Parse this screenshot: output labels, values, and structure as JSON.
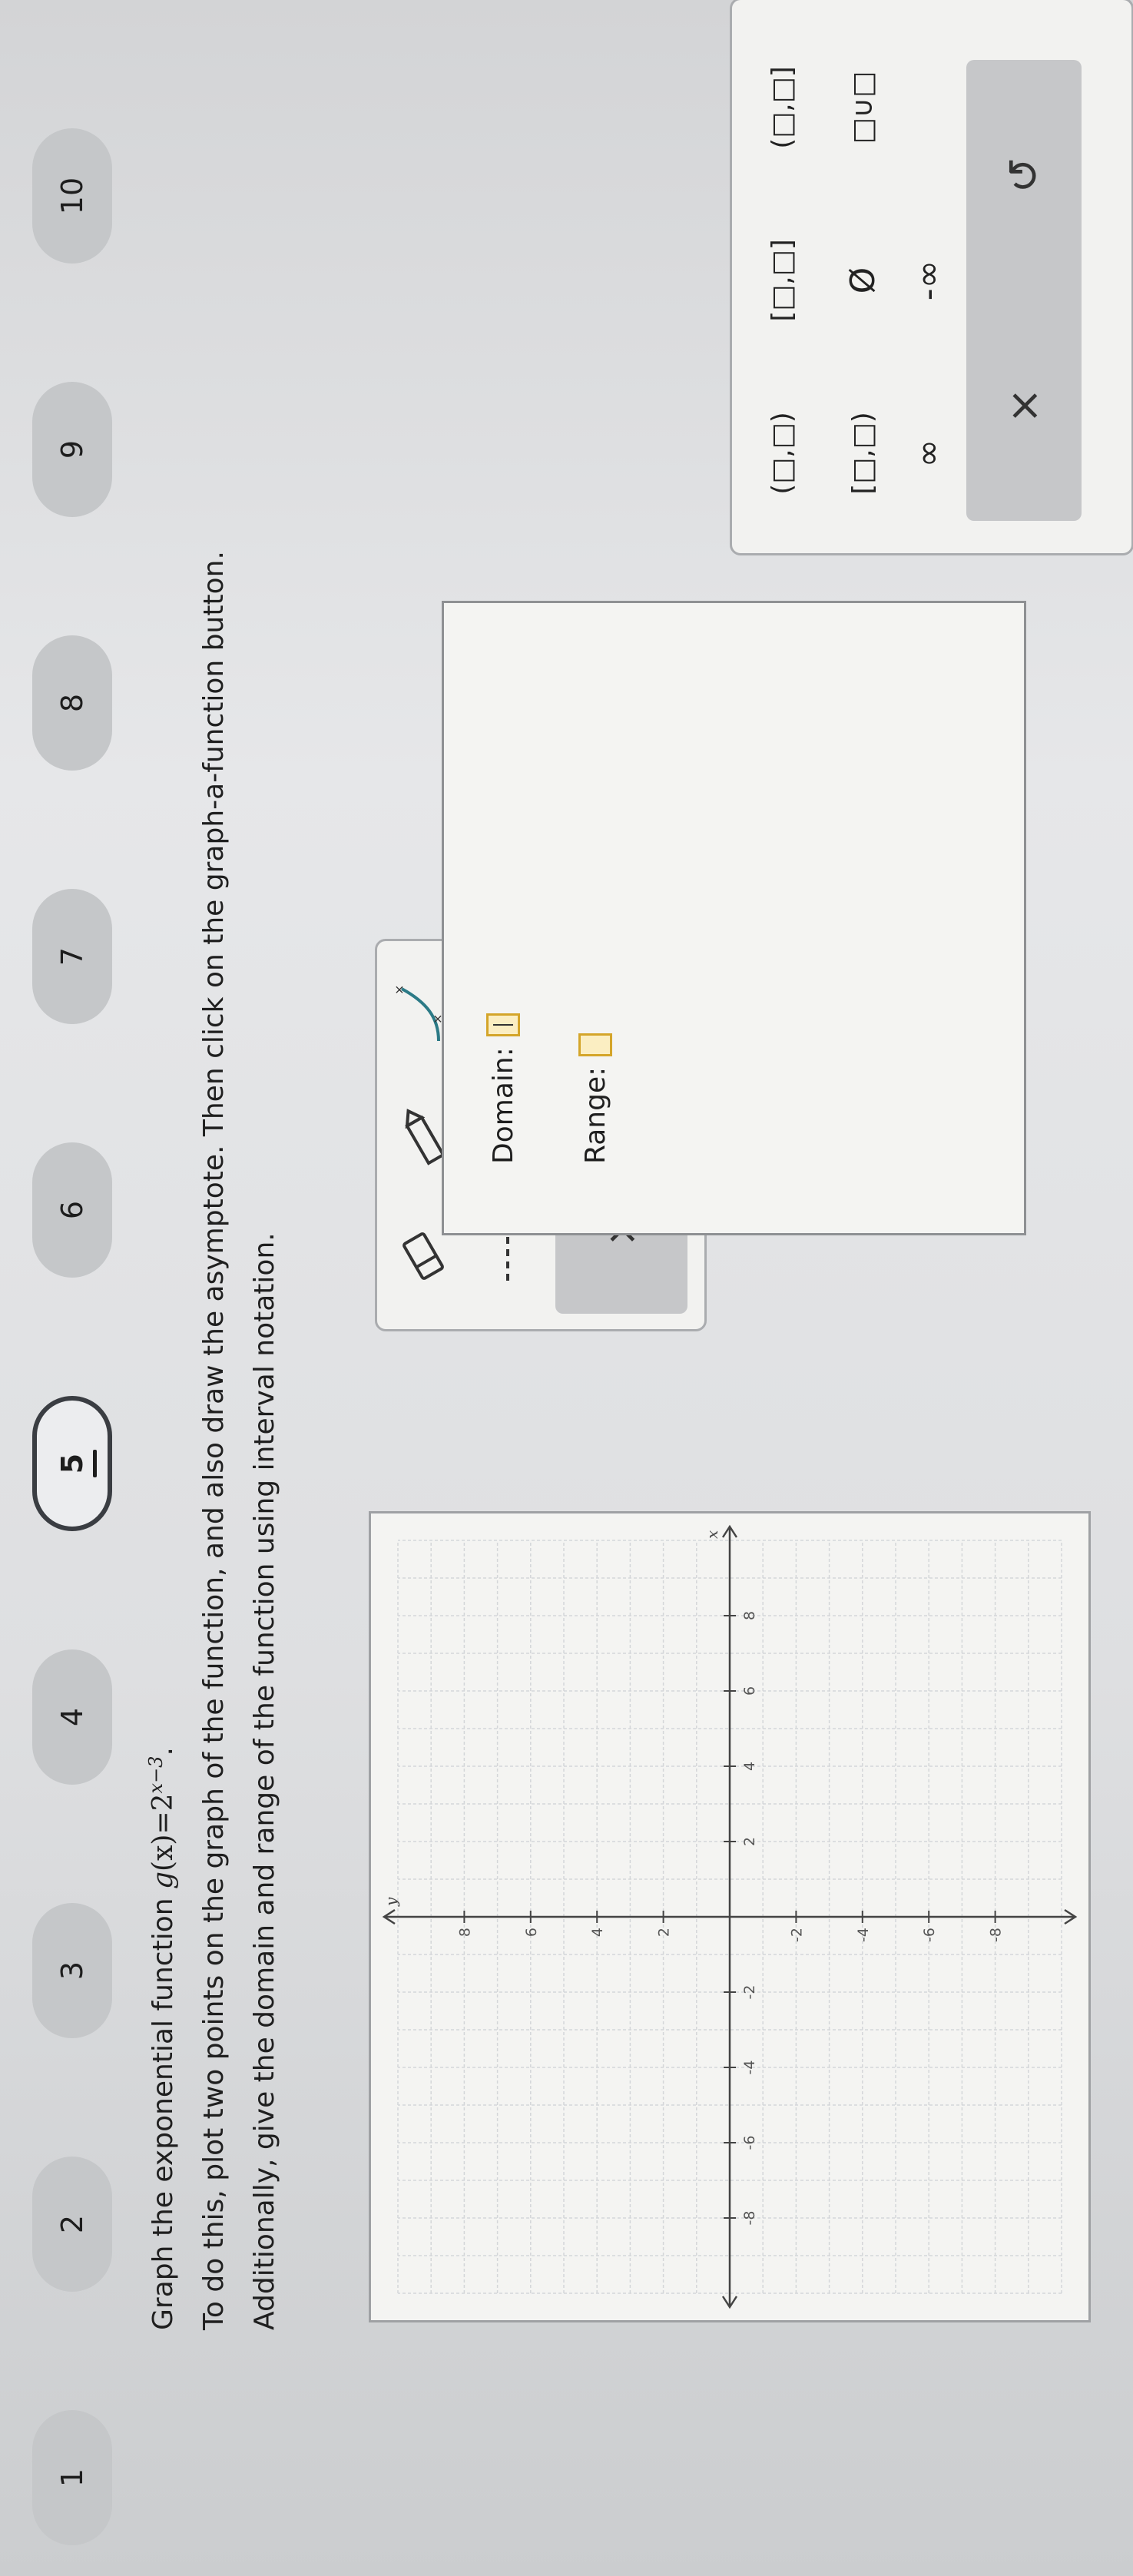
{
  "nav": {
    "questions": [
      {
        "label": "1"
      },
      {
        "label": "2"
      },
      {
        "label": "3"
      },
      {
        "label": "4"
      },
      {
        "label": "5",
        "current": true
      },
      {
        "label": "6"
      },
      {
        "label": "7"
      },
      {
        "label": "8"
      },
      {
        "label": "9"
      },
      {
        "label": "10"
      }
    ]
  },
  "prompt": {
    "line1_prefix": "Graph the exponential function ",
    "fn_name": "g",
    "fn_arg": "(x)",
    "fn_eq": "=2",
    "fn_exp": "x−3",
    "fn_end": ".",
    "line2": "To do this, plot two points on the graph of the function, and also draw the asymptote. Then click on the graph-a-function button.",
    "line3": "Additionally, give the domain and range of the function using interval notation."
  },
  "graph": {
    "x_label": "x",
    "y_label": "y",
    "x_min": -10,
    "x_max": 10,
    "y_min": -10,
    "y_max": 10,
    "tick_labels": [
      -8,
      -6,
      -4,
      -2,
      2,
      4,
      6,
      8
    ]
  },
  "tools": {
    "eraser_icon": "eraser-icon",
    "pencil_icon": "pencil-icon",
    "curve_icon": "exponential-curve-icon",
    "asymptote_icon": "dashed-line-icon",
    "graph_function_icon": "graph-a-function-icon",
    "clear_label": "×",
    "undo_label": "↺"
  },
  "answer": {
    "domain_label": "Domain:",
    "range_label": "Range:"
  },
  "keypad": {
    "keys": [
      "(□,□)",
      "[□,□]",
      "(□,□]",
      "[□,□)",
      "Ø",
      "□∪□",
      "∞",
      "-∞"
    ],
    "clear_label": "×",
    "undo_label": "↺"
  },
  "colors": {
    "slot_fill": "#fbeec2",
    "slot_border": "#d4a52a",
    "tool_accent": "#2c7a86"
  }
}
